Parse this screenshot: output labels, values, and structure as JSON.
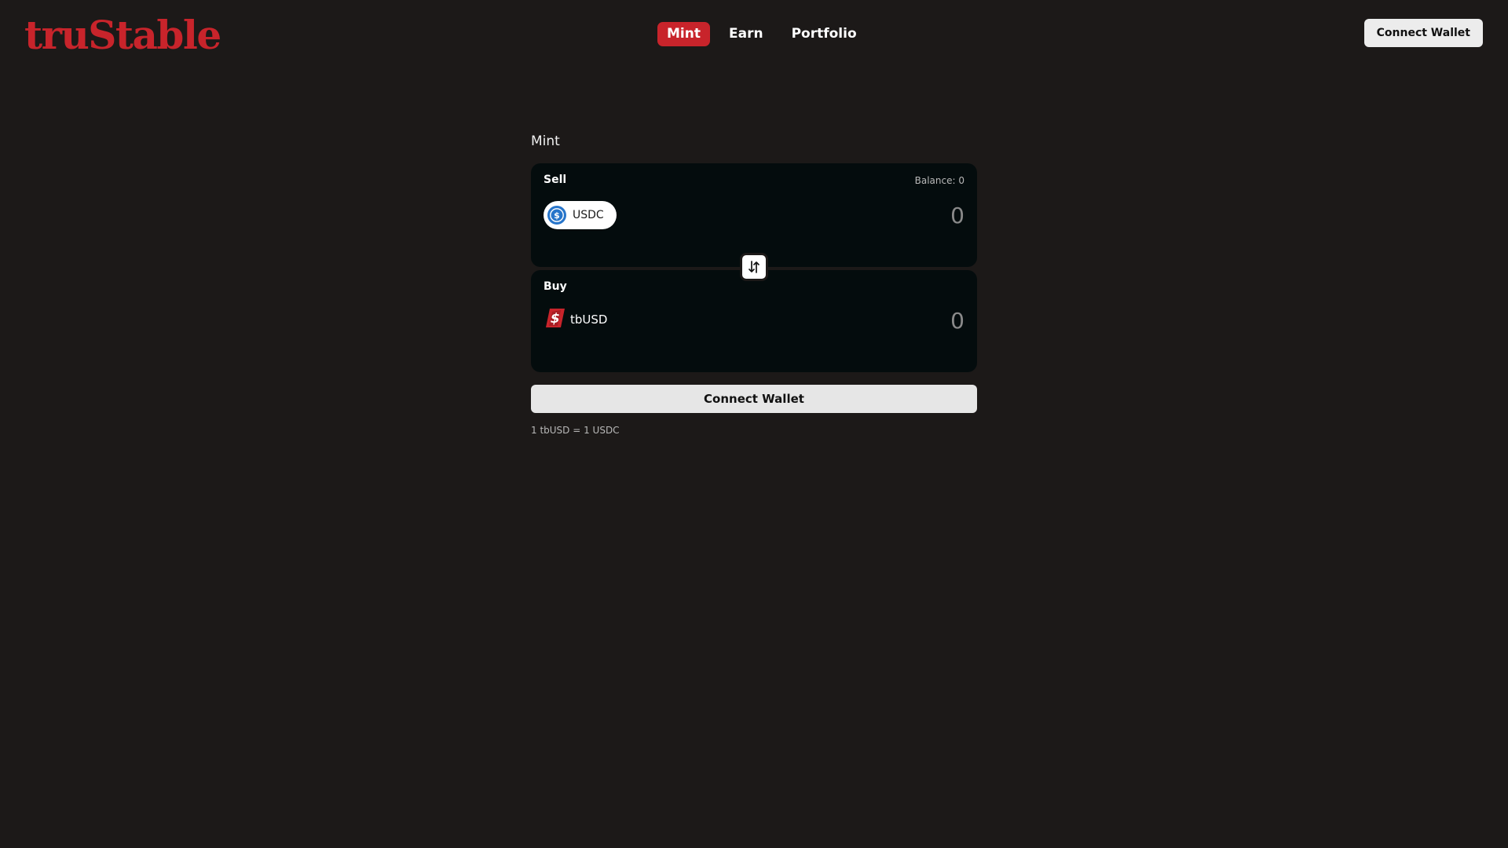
{
  "app": {
    "logo_text": "truStable"
  },
  "nav": {
    "tabs": [
      {
        "label": "Mint",
        "active": true
      },
      {
        "label": "Earn",
        "active": false
      },
      {
        "label": "Portfolio",
        "active": false
      }
    ]
  },
  "header": {
    "connect_label": "Connect Wallet"
  },
  "mint": {
    "title": "Mint",
    "sell": {
      "label": "Sell",
      "balance": "Balance: 0",
      "token": "USDC",
      "token_icon": "usdc-icon",
      "amount_placeholder": "0"
    },
    "buy": {
      "label": "Buy",
      "token": "tbUSD",
      "token_icon": "tbusd-icon",
      "amount_placeholder": "0"
    },
    "swap_icon": "swap-arrows-icon",
    "connect_label": "Connect Wallet",
    "rate": "1 tbUSD = 1 USDC"
  },
  "colors": {
    "background": "#1c1918",
    "accent": "#c8242b",
    "card": "#040c0d",
    "usdc_blue": "#2775ca"
  }
}
